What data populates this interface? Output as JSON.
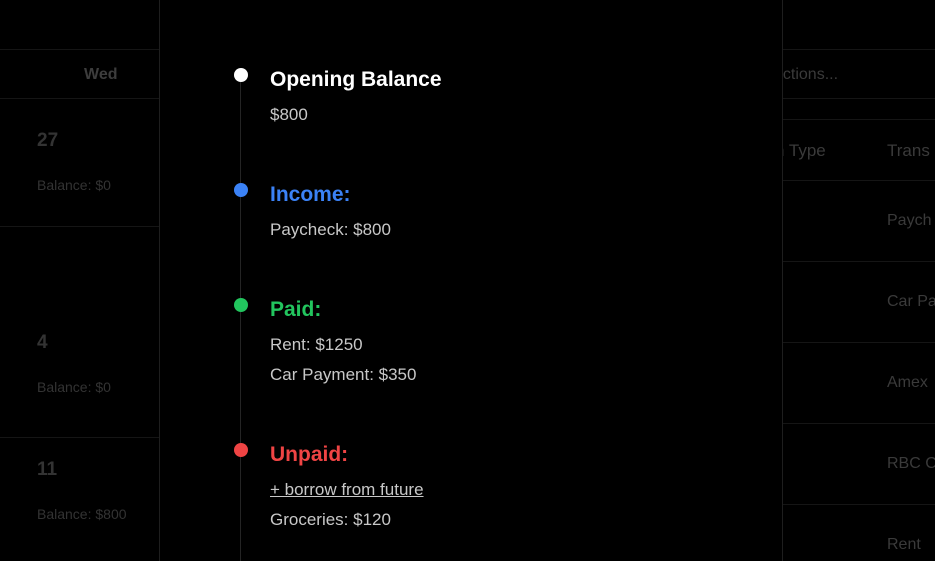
{
  "calendar": {
    "weekday": "Wed",
    "days": [
      {
        "day": "27",
        "balance": "Balance: $0"
      },
      {
        "day": "4",
        "balance": "Balance: $0"
      },
      {
        "day": "11",
        "balance": "Balance: $800"
      }
    ]
  },
  "transactions": {
    "search_placeholder": "actions...",
    "columns": [
      "n Type",
      "Trans"
    ],
    "rows": [
      "Paych",
      "Car Pa",
      "Amex",
      "RBC C",
      "Rent"
    ]
  },
  "timeline": {
    "opening": {
      "title": "Opening Balance",
      "amount": "$800",
      "color": "#ffffff"
    },
    "income": {
      "title": "Income:",
      "color": "#3b82f6",
      "items": [
        "Paycheck: $800"
      ]
    },
    "paid": {
      "title": "Paid:",
      "color": "#22c55e",
      "items": [
        "Rent: $1250",
        "Car Payment: $350"
      ]
    },
    "unpaid": {
      "title": "Unpaid:",
      "color": "#ef4444",
      "borrow_link": "+ borrow from future",
      "items": [
        "Groceries: $120"
      ]
    }
  }
}
